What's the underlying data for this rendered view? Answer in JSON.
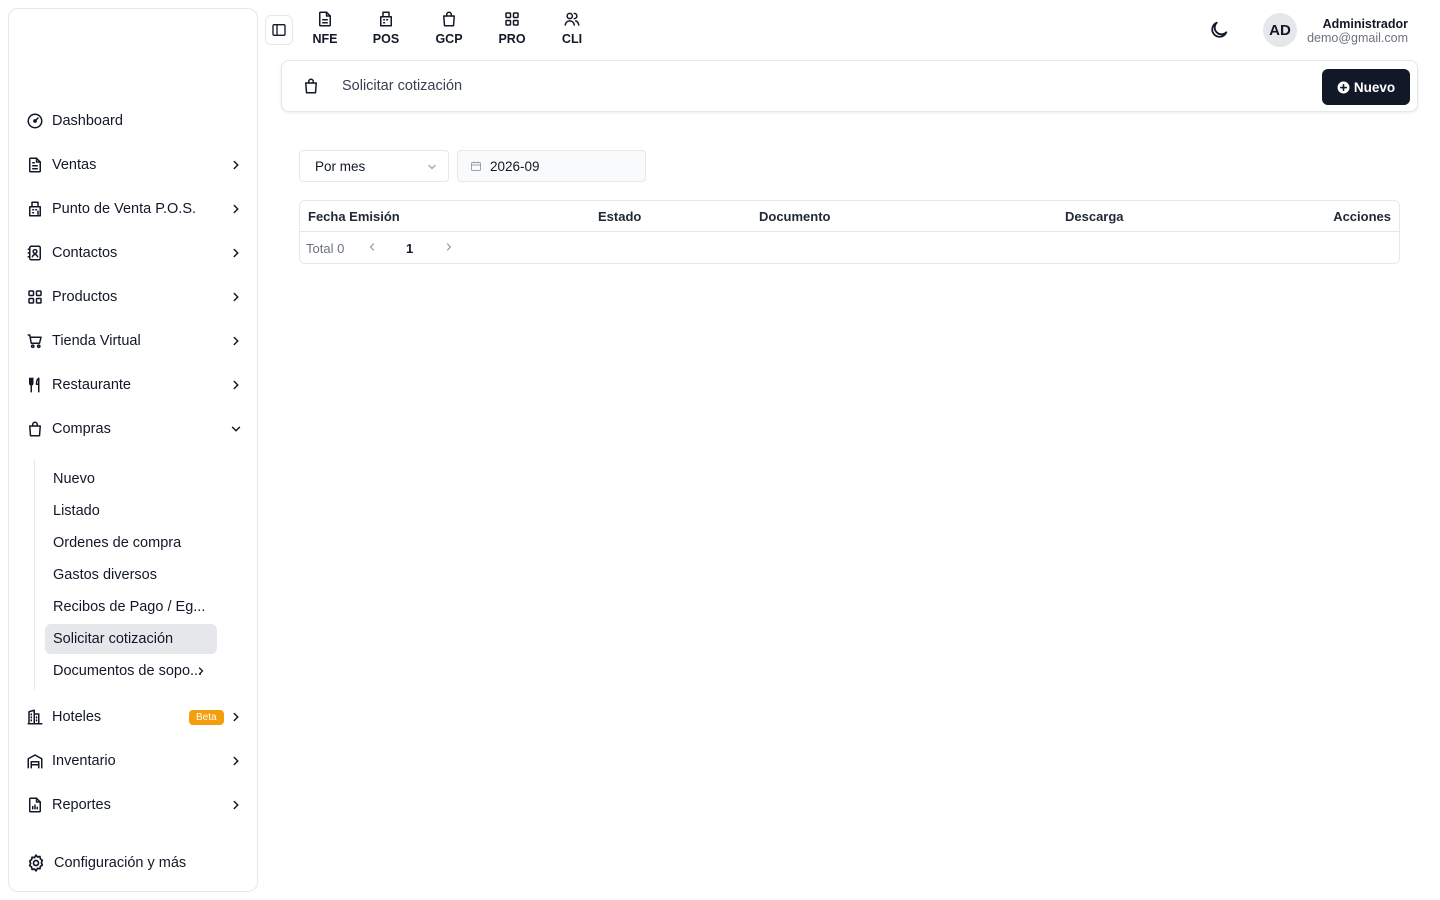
{
  "sidebar": {
    "items": [
      {
        "label": "Dashboard"
      },
      {
        "label": "Ventas"
      },
      {
        "label": "Punto de Venta P.O.S."
      },
      {
        "label": "Contactos"
      },
      {
        "label": "Productos"
      },
      {
        "label": "Tienda Virtual"
      },
      {
        "label": "Restaurante"
      },
      {
        "label": "Compras"
      },
      {
        "label": "Hoteles",
        "badge": "Beta"
      },
      {
        "label": "Inventario"
      },
      {
        "label": "Reportes"
      },
      {
        "label": "Configuración y más"
      }
    ],
    "compras_sub": [
      {
        "label": "Nuevo"
      },
      {
        "label": "Listado"
      },
      {
        "label": "Ordenes de compra"
      },
      {
        "label": "Gastos diversos"
      },
      {
        "label": "Recibos de Pago / Eg..."
      },
      {
        "label": "Solicitar cotización"
      },
      {
        "label": "Documentos de sopo..."
      }
    ]
  },
  "topnav": [
    {
      "label": "NFE"
    },
    {
      "label": "POS"
    },
    {
      "label": "GCP"
    },
    {
      "label": "PRO"
    },
    {
      "label": "CLI"
    }
  ],
  "user": {
    "initials": "AD",
    "name": "Administrador",
    "email": "demo@gmail.com"
  },
  "header": {
    "title": "Solicitar cotización",
    "new_label": "Nuevo"
  },
  "filters": {
    "period": "Por mes",
    "date": "2026-09"
  },
  "table": {
    "columns": [
      "Fecha Emisión",
      "Estado",
      "Documento",
      "Descarga",
      "Acciones"
    ],
    "rows": [],
    "total_label": "Total 0",
    "page": "1"
  },
  "colors": {
    "primary": "#111827",
    "beta_badge": "#f59e0b",
    "active_bg": "#e5e7eb",
    "border": "#e5e7eb"
  }
}
